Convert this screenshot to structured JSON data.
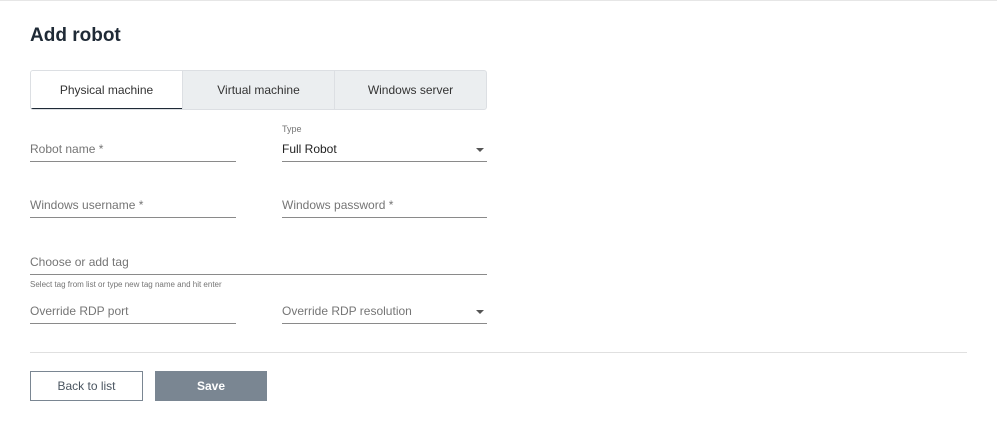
{
  "page": {
    "title": "Add robot"
  },
  "tabs": [
    {
      "label": "Physical machine",
      "active": true
    },
    {
      "label": "Virtual machine",
      "active": false
    },
    {
      "label": "Windows server",
      "active": false
    }
  ],
  "form": {
    "robot_name": {
      "placeholder": "Robot name *"
    },
    "type": {
      "label": "Type",
      "value": "Full Robot"
    },
    "windows_username": {
      "placeholder": "Windows username *"
    },
    "windows_password": {
      "placeholder": "Windows password *"
    },
    "tag": {
      "placeholder": "Choose or add tag",
      "hint": "Select tag from list or type new tag name and hit enter"
    },
    "rdp_port": {
      "placeholder": "Override RDP port"
    },
    "rdp_resolution": {
      "placeholder": "Override RDP resolution"
    }
  },
  "actions": {
    "back_label": "Back to list",
    "save_label": "Save"
  },
  "colors": {
    "accent": "#1f2a36",
    "save_button": "#7a8692"
  }
}
